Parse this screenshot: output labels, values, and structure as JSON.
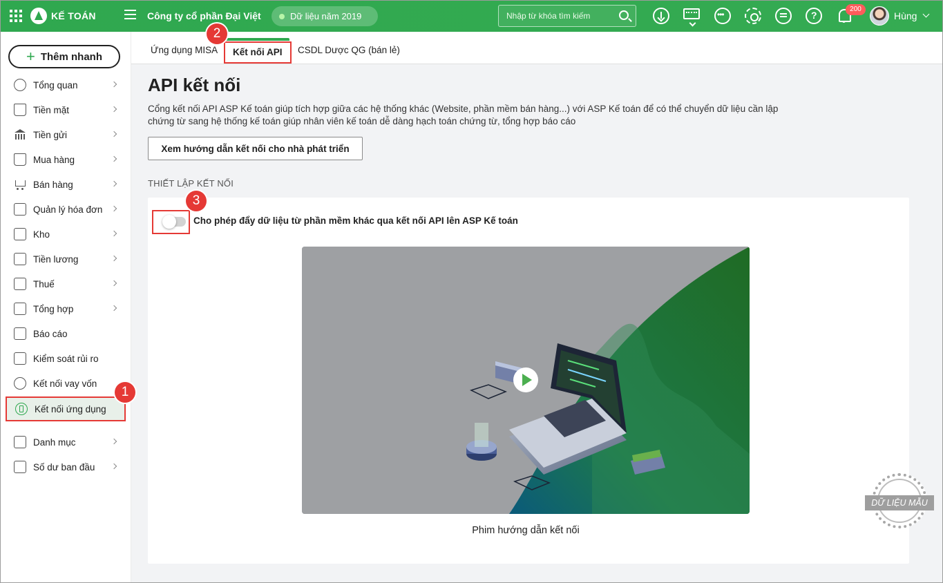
{
  "header": {
    "logo_text": "KẾ TOÁN",
    "company": "Công ty cổ phần Đại Việt",
    "data_year": "Dữ liệu năm 2019",
    "search_placeholder": "Nhập từ khóa tìm kiếm",
    "notification_count": "200",
    "user_name": "Hùng",
    "icons": [
      "apps-grid-icon",
      "hamburger-menu-icon",
      "download-icon",
      "keyboard-icon",
      "more-icon",
      "gear-icon",
      "chat-icon",
      "help-icon",
      "bell-icon"
    ]
  },
  "sidebar": {
    "quick_add": "Thêm nhanh",
    "items": [
      {
        "label": "Tổng quan",
        "icon": "chart-pie-icon",
        "chevron": true
      },
      {
        "label": "Tiền mặt",
        "icon": "money-bag-icon",
        "chevron": true
      },
      {
        "label": "Tiền gửi",
        "icon": "bank-icon",
        "chevron": true
      },
      {
        "label": "Mua hàng",
        "icon": "shopping-bag-icon",
        "chevron": true
      },
      {
        "label": "Bán hàng",
        "icon": "cart-icon",
        "chevron": true
      },
      {
        "label": "Quản lý hóa đơn",
        "icon": "invoice-icon",
        "chevron": true
      },
      {
        "label": "Kho",
        "icon": "warehouse-icon",
        "chevron": true
      },
      {
        "label": "Tiền lương",
        "icon": "salary-icon",
        "chevron": true
      },
      {
        "label": "Thuế",
        "icon": "tax-icon",
        "chevron": true
      },
      {
        "label": "Tổng hợp",
        "icon": "notebook-icon",
        "chevron": true
      },
      {
        "label": "Báo cáo",
        "icon": "report-icon",
        "chevron": false
      },
      {
        "label": "Kiểm soát rủi ro",
        "icon": "checklist-icon",
        "chevron": false
      },
      {
        "label": "Kết nối vay vốn",
        "icon": "loan-link-icon",
        "chevron": false
      },
      {
        "label": "Kết nối ứng dụng",
        "icon": "plug-icon",
        "chevron": false,
        "active": true
      },
      {
        "label": "Danh mục",
        "icon": "folder-icon",
        "chevron": true
      },
      {
        "label": "Số dư ban đầu",
        "icon": "opening-balance-icon",
        "chevron": true
      }
    ]
  },
  "tabs": [
    {
      "label": "Ứng dụng MISA"
    },
    {
      "label": "Kết nối API",
      "active": true
    },
    {
      "label": "CSDL Dược QG (bán lẻ)"
    }
  ],
  "main": {
    "title": "API kết nối",
    "description_line1": "Cổng kết nối API ASP Kế toán giúp tích hợp giữa các hệ thống khác (Website, phần mềm bán hàng...) với ASP Kế toán để có thể chuyển dữ liệu cần lập",
    "description_line2": "chứng từ sang hệ thống kế toán giúp nhân viên kế toán dễ dàng hạch toán chứng từ, tổng hợp báo cáo",
    "dev_guide_button": "Xem hướng dẫn kết nối cho nhà phát triển",
    "section_title": "THIẾT LẬP KẾT NỐI",
    "toggle_label": "Cho phép đẩy dữ liệu từ phần mềm khác qua kết nối API lên ASP Kế toán",
    "toggle_on": false,
    "video_caption": "Phim hướng dẫn kết nối"
  },
  "annotations": {
    "step1": "1",
    "step2": "2",
    "step3": "3"
  },
  "watermark": "DỮ LIỆU MẪU",
  "colors": {
    "brand_green": "#2fa84f",
    "highlight_red": "#e53935",
    "badge_red": "#ff5b5b"
  }
}
